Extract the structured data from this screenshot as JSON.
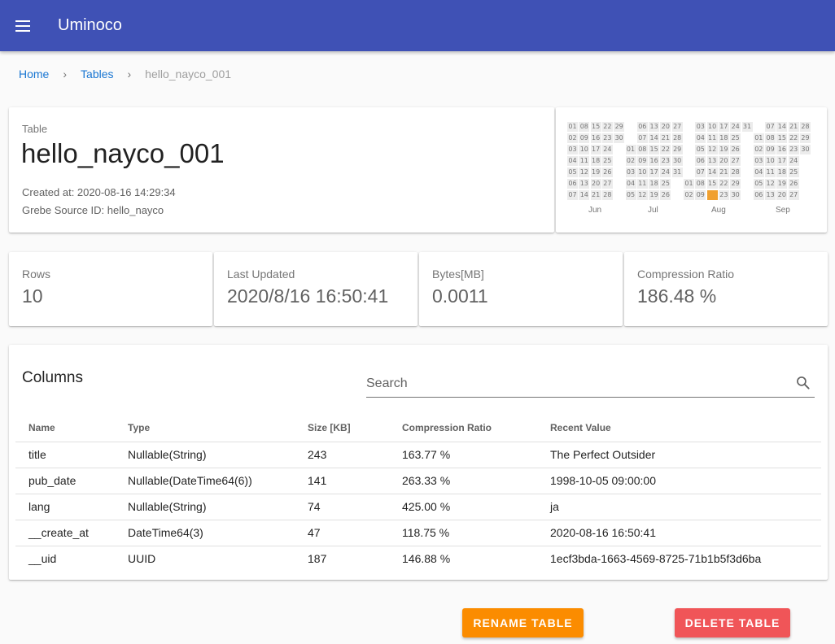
{
  "app": {
    "title": "Uminoco"
  },
  "breadcrumb": {
    "home": "Home",
    "tables": "Tables",
    "current": "hello_nayco_001"
  },
  "table_info": {
    "kind_label": "Table",
    "name": "hello_nayco_001",
    "created_at": "Created at: 2020-08-16 14:29:34",
    "source_id": "Grebe Source ID: hello_nayco"
  },
  "calendar": {
    "months": [
      "Jun",
      "Jul",
      "Aug",
      "Sep"
    ],
    "active_color": "#f0a030",
    "columns": [
      {
        "row_start": 0,
        "days": [
          "01",
          "02",
          "03",
          "04",
          "05",
          "06",
          "07"
        ]
      },
      {
        "row_start": 0,
        "days": [
          "08",
          "09",
          "10",
          "11",
          "12",
          "13",
          "14"
        ]
      },
      {
        "row_start": 0,
        "days": [
          "15",
          "16",
          "17",
          "18",
          "19",
          "20",
          "21"
        ]
      },
      {
        "row_start": 0,
        "days": [
          "22",
          "23",
          "24",
          "25",
          "26",
          "27",
          "28"
        ]
      },
      {
        "row_start": 0,
        "days": [
          "29",
          "30"
        ]
      },
      {
        "row_start": 2,
        "days": [
          "01",
          "02",
          "03",
          "04",
          "05"
        ]
      },
      {
        "row_start": 0,
        "days": [
          "06",
          "07",
          "08",
          "09",
          "10",
          "11",
          "12"
        ]
      },
      {
        "row_start": 0,
        "days": [
          "13",
          "14",
          "15",
          "16",
          "17",
          "18",
          "19"
        ]
      },
      {
        "row_start": 0,
        "days": [
          "20",
          "21",
          "22",
          "23",
          "24",
          "25",
          "26"
        ]
      },
      {
        "row_start": 0,
        "days": [
          "27",
          "28",
          "29",
          "30",
          "31"
        ]
      },
      {
        "row_start": 5,
        "days": [
          "01",
          "02"
        ]
      },
      {
        "row_start": 0,
        "days": [
          "03",
          "04",
          "05",
          "06",
          "07",
          "08",
          "09"
        ]
      },
      {
        "row_start": 0,
        "days": [
          "10",
          "11",
          "12",
          "13",
          "14",
          "15",
          "16"
        ],
        "active": "16"
      },
      {
        "row_start": 0,
        "days": [
          "17",
          "18",
          "19",
          "20",
          "21",
          "22",
          "23"
        ]
      },
      {
        "row_start": 0,
        "days": [
          "24",
          "25",
          "26",
          "27",
          "28",
          "29",
          "30"
        ]
      },
      {
        "row_start": 0,
        "days": [
          "31"
        ]
      },
      {
        "row_start": 1,
        "days": [
          "01",
          "02",
          "03",
          "04",
          "05",
          "06"
        ]
      },
      {
        "row_start": 0,
        "days": [
          "07",
          "08",
          "09",
          "10",
          "11",
          "12",
          "13"
        ]
      },
      {
        "row_start": 0,
        "days": [
          "14",
          "15",
          "16",
          "17",
          "18",
          "19",
          "20"
        ]
      },
      {
        "row_start": 0,
        "days": [
          "21",
          "22",
          "23",
          "24",
          "25",
          "26",
          "27"
        ]
      },
      {
        "row_start": 0,
        "days": [
          "28",
          "29",
          "30"
        ]
      }
    ]
  },
  "stats": {
    "rows": {
      "label": "Rows",
      "value": "10"
    },
    "last_updated": {
      "label": "Last Updated",
      "value": "2020/8/16 16:50:41"
    },
    "bytes": {
      "label": "Bytes[MB]",
      "value": "0.0011"
    },
    "compression": {
      "label": "Compression Ratio",
      "value": "186.48 %"
    }
  },
  "columns_section": {
    "title": "Columns",
    "search_placeholder": "Search",
    "headers": [
      "Name",
      "Type",
      "Size [KB]",
      "Compression Ratio",
      "Recent Value"
    ],
    "rows": [
      [
        "title",
        "Nullable(String)",
        "243",
        "163.77 %",
        "The Perfect Outsider"
      ],
      [
        "pub_date",
        "Nullable(DateTime64(6))",
        "141",
        "263.33 %",
        "1998-10-05 09:00:00"
      ],
      [
        "lang",
        "Nullable(String)",
        "74",
        "425.00 %",
        "ja"
      ],
      [
        "__create_at",
        "DateTime64(3)",
        "47",
        "118.75 %",
        "2020-08-16 16:50:41"
      ],
      [
        "__uid",
        "UUID",
        "187",
        "146.88 %",
        "1ecf3bda-1663-4569-8725-71b1b5f3d6ba"
      ]
    ]
  },
  "actions": {
    "rename": "RENAME TABLE",
    "delete": "DELETE TABLE"
  }
}
